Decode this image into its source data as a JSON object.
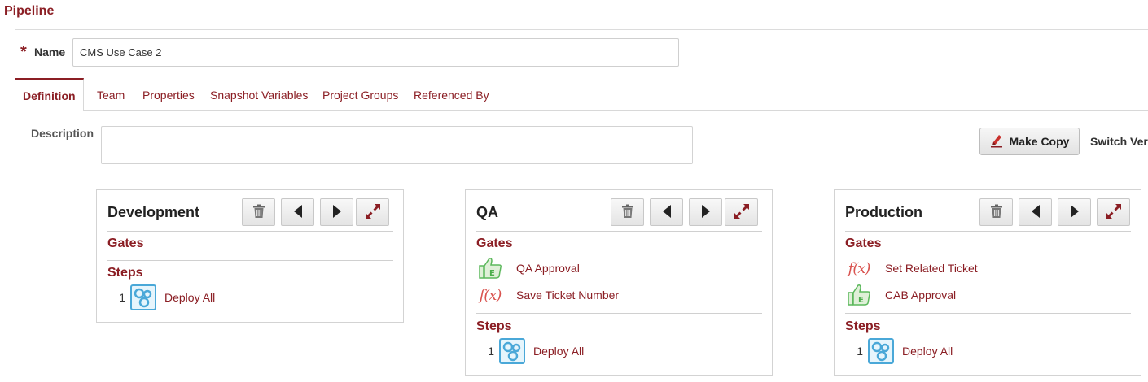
{
  "header": {
    "title": "Pipeline"
  },
  "name_field": {
    "required_marker": "*",
    "label": "Name",
    "value": "CMS Use Case 2"
  },
  "tabs": [
    {
      "label": "Definition",
      "active": true
    },
    {
      "label": "Team"
    },
    {
      "label": "Properties"
    },
    {
      "label": "Snapshot Variables"
    },
    {
      "label": "Project Groups"
    },
    {
      "label": "Referenced By"
    }
  ],
  "definition": {
    "description_label": "Description",
    "description_value": "",
    "make_copy_label": "Make Copy",
    "switch_version_label": "Switch Ver"
  },
  "stages": [
    {
      "name": "Development",
      "gates_label": "Gates",
      "gates": [],
      "steps_label": "Steps",
      "steps": [
        {
          "number": "1",
          "label": "Deploy All"
        }
      ]
    },
    {
      "name": "QA",
      "gates_label": "Gates",
      "gates": [
        {
          "label": "QA Approval",
          "icon": "thumbs-up-approval-icon"
        },
        {
          "label": "Save Ticket Number",
          "icon": "function-icon"
        }
      ],
      "steps_label": "Steps",
      "steps": [
        {
          "number": "1",
          "label": "Deploy All"
        }
      ]
    },
    {
      "name": "Production",
      "gates_label": "Gates",
      "gates": [
        {
          "label": "Set Related Ticket",
          "icon": "function-icon"
        },
        {
          "label": "CAB Approval",
          "icon": "thumbs-up-approval-icon"
        }
      ],
      "steps_label": "Steps",
      "steps": [
        {
          "number": "1",
          "label": "Deploy All"
        }
      ]
    }
  ],
  "colors": {
    "brand": "#8b1e24",
    "function_icon": "#d9534f",
    "approval_icon": "#5cb85c",
    "step_icon": "#4aa8d8"
  }
}
